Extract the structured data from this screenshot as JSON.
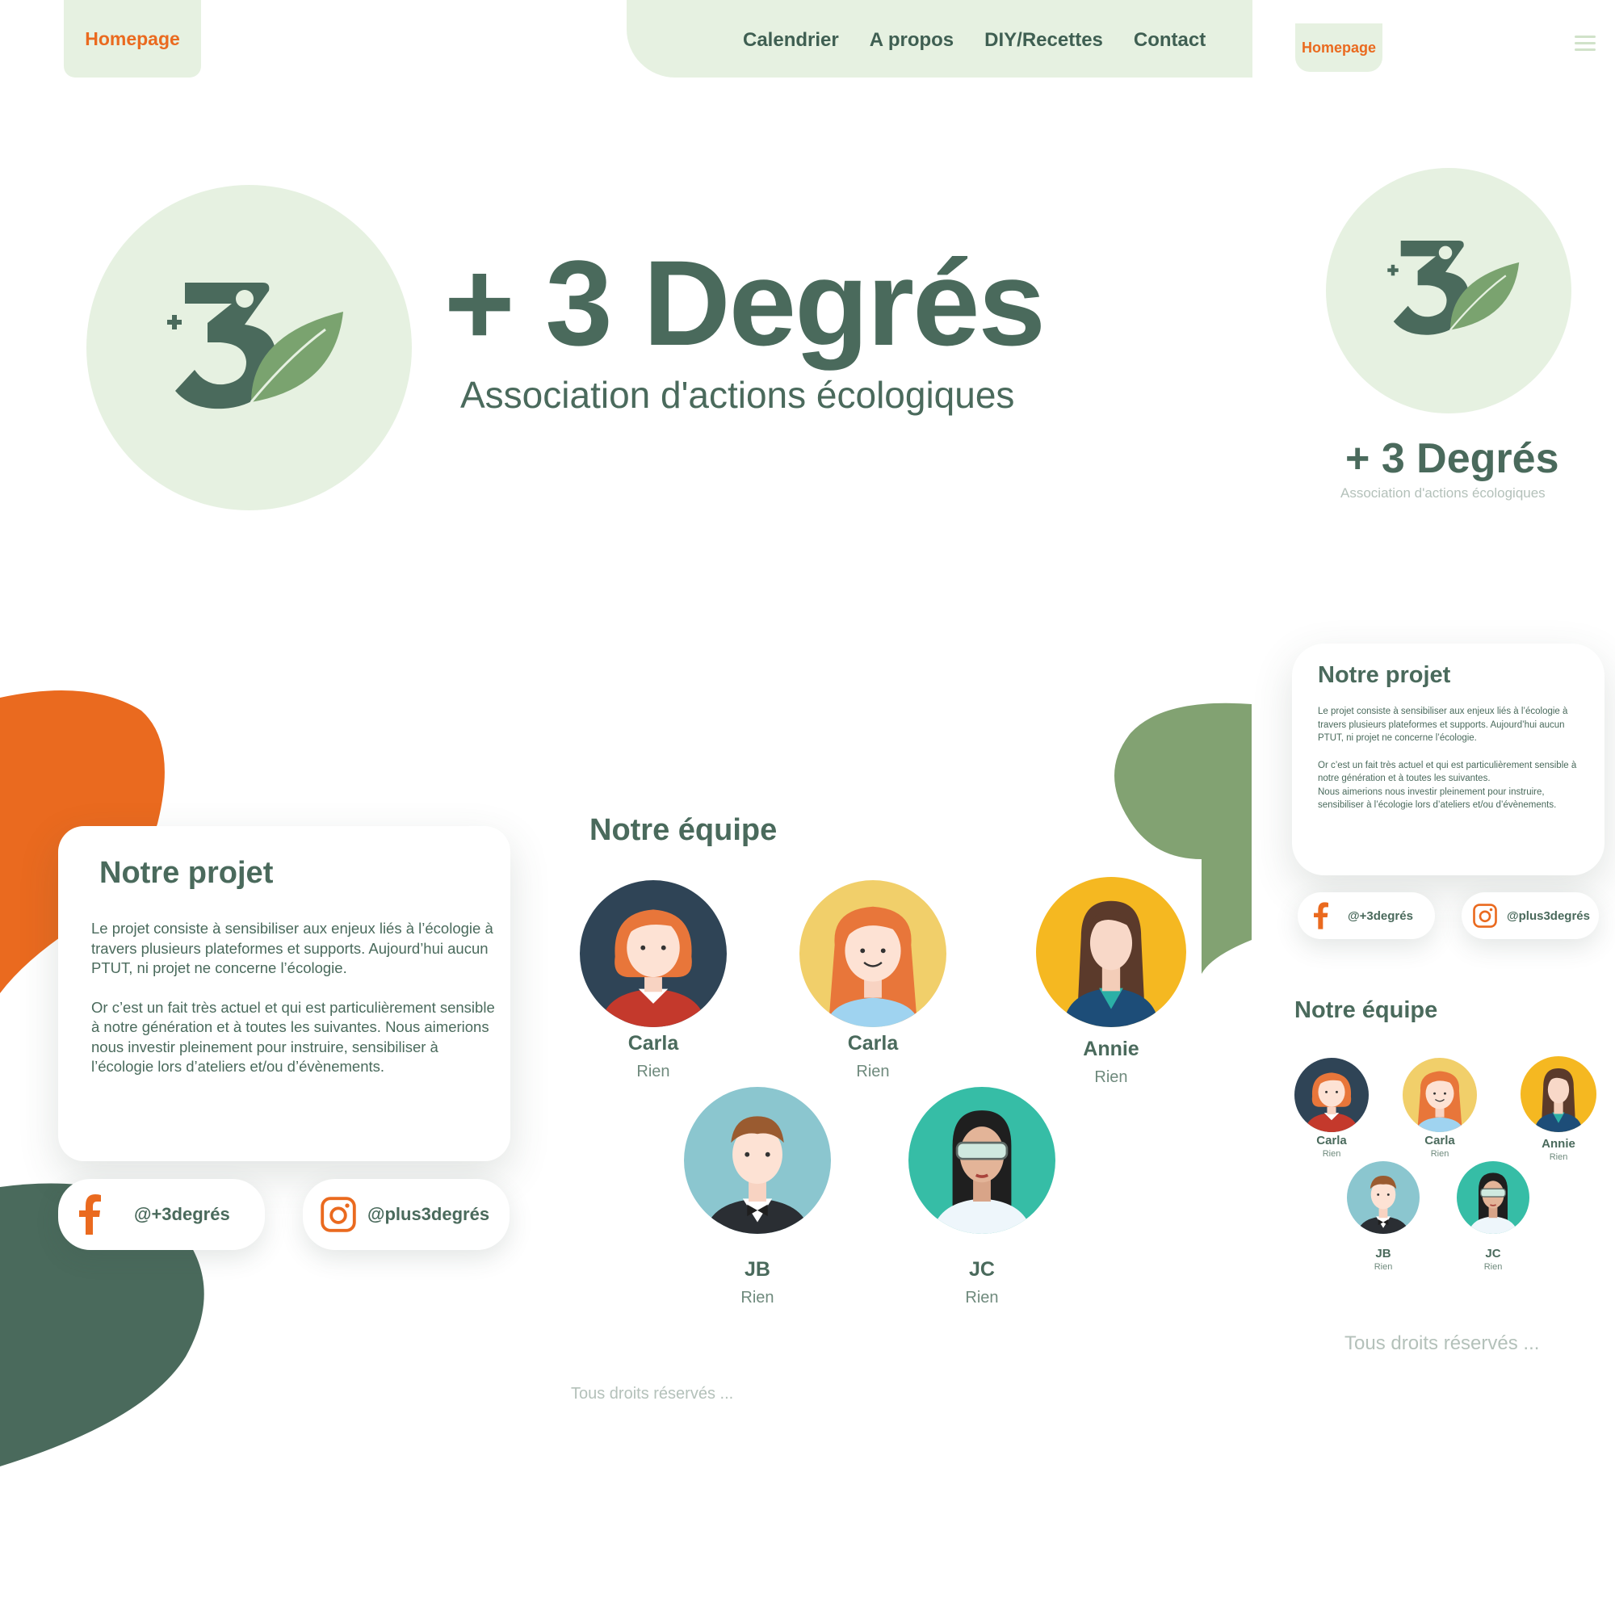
{
  "colors": {
    "brand_green": "#4a6a5c",
    "light_green": "#e6f1e1",
    "accent_orange": "#ea6a1f",
    "leaf_green": "#7aa36f",
    "blob_green": "#82a272"
  },
  "desktop": {
    "nav": {
      "home_label": "Homepage",
      "items": [
        {
          "label": "Calendrier"
        },
        {
          "label": "A propos"
        },
        {
          "label": "DIY/Recettes"
        },
        {
          "label": "Contact"
        }
      ]
    },
    "hero": {
      "logo_icon": "plus-three-leaf-logo",
      "title": "+ 3 Degrés",
      "subtitle": "Association d'actions écologiques"
    },
    "project": {
      "title": "Notre projet",
      "paragraph1": "Le projet consiste à sensibiliser aux enjeux liés à l’écologie à travers  plusieurs plateformes et supports. Aujourd’hui aucun PTUT, ni projet ne concerne l’écologie.",
      "paragraph2": "Or c’est un fait très actuel et qui est  particulièrement sensible à notre  génération et à toutes les suivantes. Nous aimerions nous investir  pleinement pour instruire, sensibiliser  à l’écologie lors d’ateliers et/ou d’évènements."
    },
    "social": {
      "facebook": {
        "icon": "facebook-icon",
        "handle": "@+3degrés"
      },
      "instagram": {
        "icon": "instagram-icon",
        "handle": "@plus3degrés"
      }
    },
    "team": {
      "title": "Notre équipe",
      "members": [
        {
          "name": "Carla",
          "role": "Rien"
        },
        {
          "name": "Carla",
          "role": "Rien"
        },
        {
          "name": "Annie",
          "role": "Rien"
        },
        {
          "name": "JB",
          "role": "Rien"
        },
        {
          "name": "JC",
          "role": "Rien"
        }
      ]
    },
    "footer": "Tous droits réservés ..."
  },
  "mobile": {
    "nav": {
      "home_label": "Homepage",
      "menu_icon": "hamburger-menu-icon"
    },
    "hero": {
      "title": "+ 3 Degrés",
      "subtitle": "Association d'actions écologiques"
    },
    "project": {
      "title": "Notre projet",
      "paragraph1": "Le projet consiste à sensibiliser aux enjeux liés à l’écologie à travers  plusieurs plateformes et supports.  Aujourd’hui aucun PTUT, ni projet ne concerne l’écologie.",
      "paragraph2": "Or c’est un fait très actuel et qui est particulièrement sensible à notre  génération et à toutes les suivantes.",
      "paragraph3": "Nous aimerions nous investir  pleinement pour instruire, sensibiliser  à l’écologie lors d’ateliers et/ou d’évènements."
    },
    "social": {
      "facebook": {
        "handle": "@+3degrés"
      },
      "instagram": {
        "handle": "@plus3degrés"
      }
    },
    "team": {
      "title": "Notre équipe",
      "members": [
        {
          "name": "Carla",
          "role": "Rien"
        },
        {
          "name": "Carla",
          "role": "Rien"
        },
        {
          "name": "Annie",
          "role": "Rien"
        },
        {
          "name": "JB",
          "role": "Rien"
        },
        {
          "name": "JC",
          "role": "Rien"
        }
      ]
    },
    "footer": "Tous droits réservés ..."
  }
}
